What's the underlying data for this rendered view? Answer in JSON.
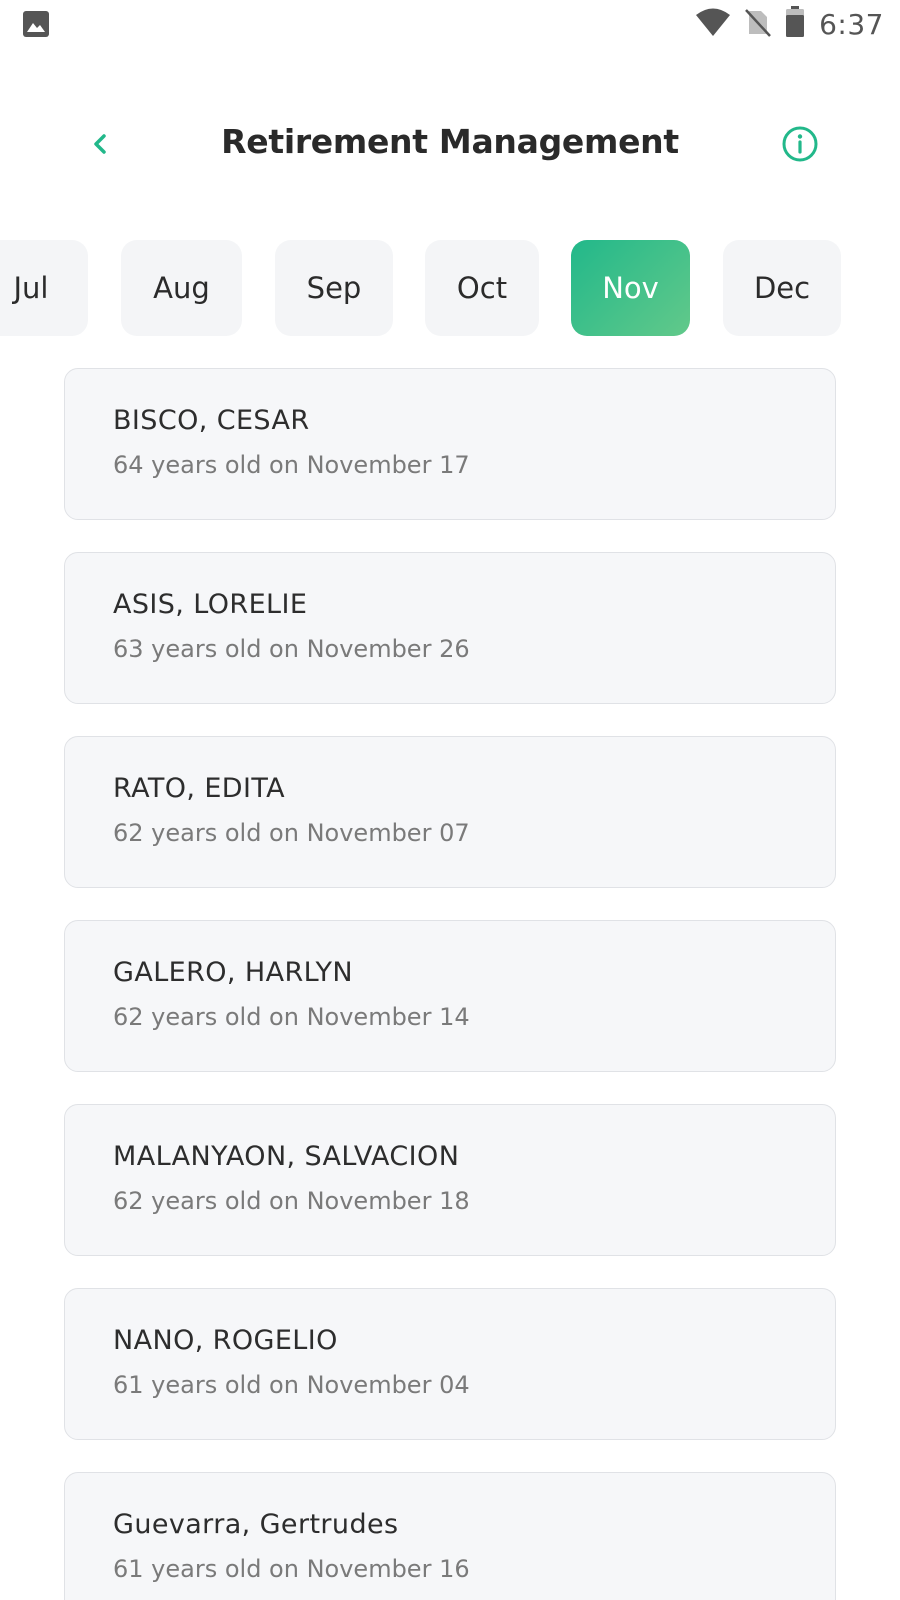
{
  "status_bar": {
    "time": "6:37",
    "icons": [
      "image-icon",
      "wifi-icon",
      "no-sim-icon",
      "battery-icon"
    ]
  },
  "header": {
    "title": "Retirement Management",
    "back_icon": "chevron-left-icon",
    "info_icon": "info-circle-icon"
  },
  "colors": {
    "accent": "#22b88a",
    "accent_end": "#62c98a",
    "card_bg": "#f6f7f9",
    "tab_bg": "#f4f5f7"
  },
  "months": {
    "selected": "Nov",
    "items": [
      {
        "label": "Jul"
      },
      {
        "label": "Aug"
      },
      {
        "label": "Sep"
      },
      {
        "label": "Oct"
      },
      {
        "label": "Nov"
      },
      {
        "label": "Dec"
      }
    ]
  },
  "retirees": [
    {
      "name": "BISCO, CESAR",
      "detail": "64 years old on November 17"
    },
    {
      "name": "ASIS, LORELIE",
      "detail": "63 years old on November 26"
    },
    {
      "name": "RATO, EDITA",
      "detail": "62 years old on November 07"
    },
    {
      "name": "GALERO, HARLYN",
      "detail": "62 years old on November 14"
    },
    {
      "name": "MALANYAON, SALVACION",
      "detail": "62 years old on November 18"
    },
    {
      "name": "NANO, ROGELIO",
      "detail": "61 years old on November 04"
    },
    {
      "name": "Guevarra, Gertrudes",
      "detail": "61 years old on November 16"
    }
  ]
}
